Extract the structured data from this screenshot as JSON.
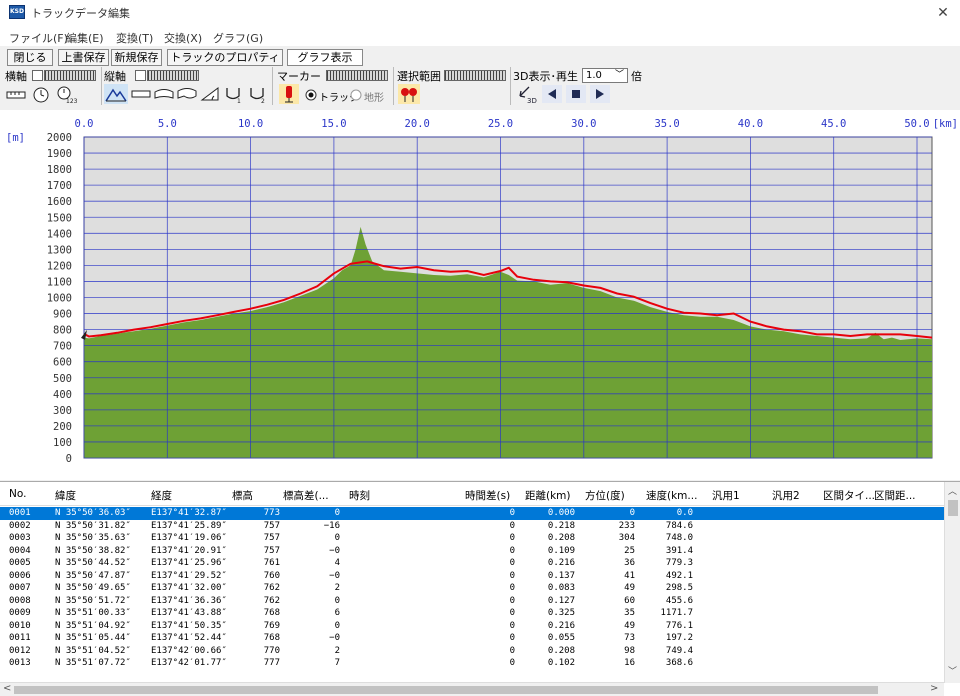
{
  "window": {
    "title": "トラックデータ編集",
    "close_glyph": "✕",
    "icon_text": "KSD"
  },
  "menu": [
    "ファイル(F)",
    "編集(E)",
    "変換(T)",
    "交換(X)",
    "グラフ(G)"
  ],
  "toolbar": {
    "close": "閉じる",
    "overwrite_save": "上書保存",
    "new_save": "新規保存",
    "track_properties": "トラックのプロパティ",
    "graph_display": "グラフ表示",
    "h_axis": "横軸",
    "v_axis": "縦軸",
    "marker": "マーカー",
    "selection": "選択範囲",
    "display_3d": "3D表示･再生",
    "zoom_value": "1.0",
    "zoom_unit": "倍",
    "radio_track": "トラック",
    "radio_terrain": "地形",
    "radio_track_selected": true,
    "play_3d_label": "3D"
  },
  "chart_data": {
    "type": "area",
    "xlabel": "[km]",
    "ylabel": "[m]",
    "xlim": [
      0,
      50.9
    ],
    "ylim": [
      0,
      2000
    ],
    "x_ticks": [
      "0.0",
      "5.0",
      "10.0",
      "15.0",
      "20.0",
      "25.0",
      "30.0",
      "35.0",
      "40.0",
      "45.0",
      "50.0"
    ],
    "y_ticks": [
      "2000",
      "1900",
      "1800",
      "1700",
      "1600",
      "1500",
      "1400",
      "1300",
      "1200",
      "1100",
      "1000",
      "900",
      "800",
      "700",
      "600",
      "500",
      "400",
      "300",
      "200",
      "100",
      "0"
    ],
    "colors": {
      "terrain": "#6ea135",
      "track": "#e8000b",
      "plot_bg": "#dedede",
      "grid": "#2a35c8"
    },
    "terrain": {
      "x": [
        0,
        0.3,
        1,
        2,
        3,
        4,
        5,
        6,
        7,
        8,
        9,
        10,
        11,
        12,
        13,
        14,
        15,
        15.5,
        16,
        16.3,
        16.6,
        16.9,
        17.3,
        18,
        19,
        20,
        21,
        22,
        23,
        24,
        25,
        25.5,
        26,
        27,
        28,
        29,
        30,
        31,
        32,
        33,
        34,
        35,
        36,
        37,
        38,
        39,
        40,
        41,
        42,
        43,
        44,
        45,
        46,
        47,
        47.5,
        48,
        48.5,
        49,
        50,
        50.9
      ],
      "y": [
        750,
        745,
        760,
        775,
        790,
        805,
        825,
        845,
        860,
        880,
        900,
        915,
        940,
        970,
        1010,
        1050,
        1120,
        1170,
        1200,
        1300,
        1440,
        1330,
        1225,
        1170,
        1160,
        1150,
        1140,
        1135,
        1145,
        1125,
        1160,
        1140,
        1105,
        1100,
        1080,
        1090,
        1060,
        1040,
        1000,
        980,
        940,
        910,
        890,
        880,
        880,
        860,
        820,
        800,
        790,
        770,
        760,
        750,
        740,
        745,
        780,
        740,
        750,
        735,
        745,
        740
      ]
    },
    "track": {
      "x": [
        0,
        0.3,
        1,
        2,
        3,
        4,
        5,
        6,
        7,
        8,
        9,
        10,
        11,
        12,
        13,
        14,
        15,
        16,
        17,
        18,
        19,
        20,
        21,
        22,
        23,
        24,
        25,
        25.5,
        26,
        27,
        28,
        29,
        30,
        31,
        32,
        33,
        34,
        35,
        36,
        37,
        38,
        39,
        40,
        41,
        42,
        43,
        44,
        45,
        46,
        47,
        48,
        49,
        50,
        50.9
      ],
      "y": [
        773,
        757,
        765,
        780,
        800,
        815,
        835,
        855,
        870,
        890,
        910,
        930,
        955,
        985,
        1025,
        1070,
        1150,
        1210,
        1225,
        1195,
        1180,
        1190,
        1170,
        1160,
        1165,
        1140,
        1165,
        1185,
        1130,
        1110,
        1100,
        1095,
        1075,
        1060,
        1025,
        1005,
        965,
        930,
        905,
        900,
        890,
        900,
        850,
        820,
        800,
        790,
        770,
        770,
        760,
        770,
        770,
        770,
        760,
        750
      ]
    }
  },
  "table": {
    "columns": [
      "No.",
      "緯度",
      "経度",
      "標高",
      "標高差(...",
      "時刻",
      "時間差(s)",
      "距離(km)",
      "方位(度)",
      "速度(km...",
      "汎用1",
      "汎用2",
      "区間タイ...",
      "区間距..."
    ],
    "rows": [
      [
        "0001",
        "N 35°50′36.03″",
        "E137°41′32.87″",
        "773",
        "0",
        "",
        "0",
        "0.000",
        "0",
        "0.0"
      ],
      [
        "0002",
        "N 35°50′31.82″",
        "E137°41′25.89″",
        "757",
        "−16",
        "",
        "0",
        "0.218",
        "233",
        "784.6"
      ],
      [
        "0003",
        "N 35°50′35.63″",
        "E137°41′19.06″",
        "757",
        "0",
        "",
        "0",
        "0.208",
        "304",
        "748.0"
      ],
      [
        "0004",
        "N 35°50′38.82″",
        "E137°41′20.91″",
        "757",
        "−0",
        "",
        "0",
        "0.109",
        "25",
        "391.4"
      ],
      [
        "0005",
        "N 35°50′44.52″",
        "E137°41′25.96″",
        "761",
        "4",
        "",
        "0",
        "0.216",
        "36",
        "779.3"
      ],
      [
        "0006",
        "N 35°50′47.87″",
        "E137°41′29.52″",
        "760",
        "−0",
        "",
        "0",
        "0.137",
        "41",
        "492.1"
      ],
      [
        "0007",
        "N 35°50′49.65″",
        "E137°41′32.00″",
        "762",
        "2",
        "",
        "0",
        "0.083",
        "49",
        "298.5"
      ],
      [
        "0008",
        "N 35°50′51.72″",
        "E137°41′36.36″",
        "762",
        "0",
        "",
        "0",
        "0.127",
        "60",
        "455.6"
      ],
      [
        "0009",
        "N 35°51′00.33″",
        "E137°41′43.88″",
        "768",
        "6",
        "",
        "0",
        "0.325",
        "35",
        "1171.7"
      ],
      [
        "0010",
        "N 35°51′04.92″",
        "E137°41′50.35″",
        "769",
        "0",
        "",
        "0",
        "0.216",
        "49",
        "776.1"
      ],
      [
        "0011",
        "N 35°51′05.44″",
        "E137°41′52.44″",
        "768",
        "−0",
        "",
        "0",
        "0.055",
        "73",
        "197.2"
      ],
      [
        "0012",
        "N 35°51′04.52″",
        "E137°42′00.66″",
        "770",
        "2",
        "",
        "0",
        "0.208",
        "98",
        "749.4"
      ],
      [
        "0013",
        "N 35°51′07.72″",
        "E137°42′01.77″",
        "777",
        "7",
        "",
        "0",
        "0.102",
        "16",
        "368.6"
      ]
    ],
    "selected_row": 0
  }
}
